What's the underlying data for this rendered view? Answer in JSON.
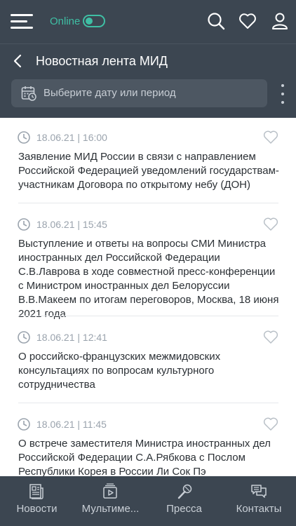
{
  "header": {
    "online_label": "Online",
    "page_title": "Новостная лента МИД",
    "date_placeholder": "Выберите дату или период",
    "accent": "#3fbfa4",
    "background": "#3c4651"
  },
  "feed": {
    "items": [
      {
        "time": "18.06.21 | 16:00",
        "headline": "Заявление МИД России в связи с направлением Российской Федерацией уведомлений государствам-участникам Договора по открытому небу (ДОН)"
      },
      {
        "time": "18.06.21 | 15:45",
        "headline": "Выступление и ответы на вопросы СМИ Министра иностранных дел Российской Федерации С.В.Лаврова в ходе совместной пресс-конференции с Министром иностранных дел Белоруссии В.В.Макеем по итогам переговоров, Москва, 18 июня 2021 года"
      },
      {
        "time": "18.06.21 | 12:41",
        "headline": "О российско-французских межмидовских консультациях по вопросам культурного сотрудничества"
      },
      {
        "time": "18.06.21 | 11:45",
        "headline": "О встрече заместителя Министра иностранных дел Российской Федерации С.А.Рябкова с Послом Республики Корея в России Ли Сок Пэ"
      }
    ]
  },
  "tabs": [
    {
      "label": "Новости",
      "icon": "newspaper-icon"
    },
    {
      "label": "Мультиме...",
      "icon": "multimedia-icon"
    },
    {
      "label": "Пресса",
      "icon": "microphone-icon"
    },
    {
      "label": "Контакты",
      "icon": "chat-icon"
    }
  ]
}
